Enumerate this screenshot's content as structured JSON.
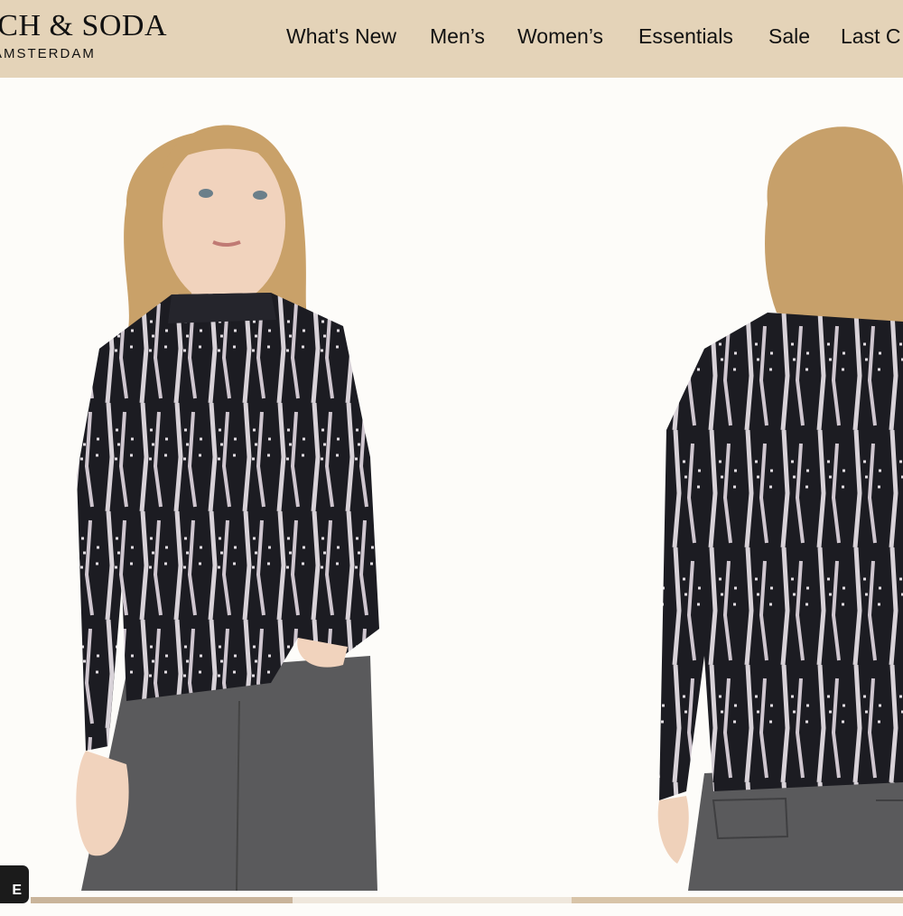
{
  "brand": {
    "name": "SCOTCH & SODA",
    "visible_name": "TCH & SODA",
    "subtitle": "AMSTERDAM"
  },
  "nav": {
    "items": [
      "What's New",
      "Men’s",
      "Women’s",
      "Essentials",
      "Sale",
      "Last C"
    ]
  },
  "gallery": {
    "images": [
      {
        "alt": "Model wearing tie-dye mock neck long sleeve top, front view"
      },
      {
        "alt": "Model wearing tie-dye mock neck long sleeve top, back view"
      }
    ]
  },
  "badge": {
    "label": "E"
  },
  "colors": {
    "header_bg": "#e4d3b8",
    "page_bg": "#fdfcf9",
    "garment_dark": "#1c1c22",
    "garment_print": "#d8d2d8",
    "denim": "#5a5a5c"
  }
}
